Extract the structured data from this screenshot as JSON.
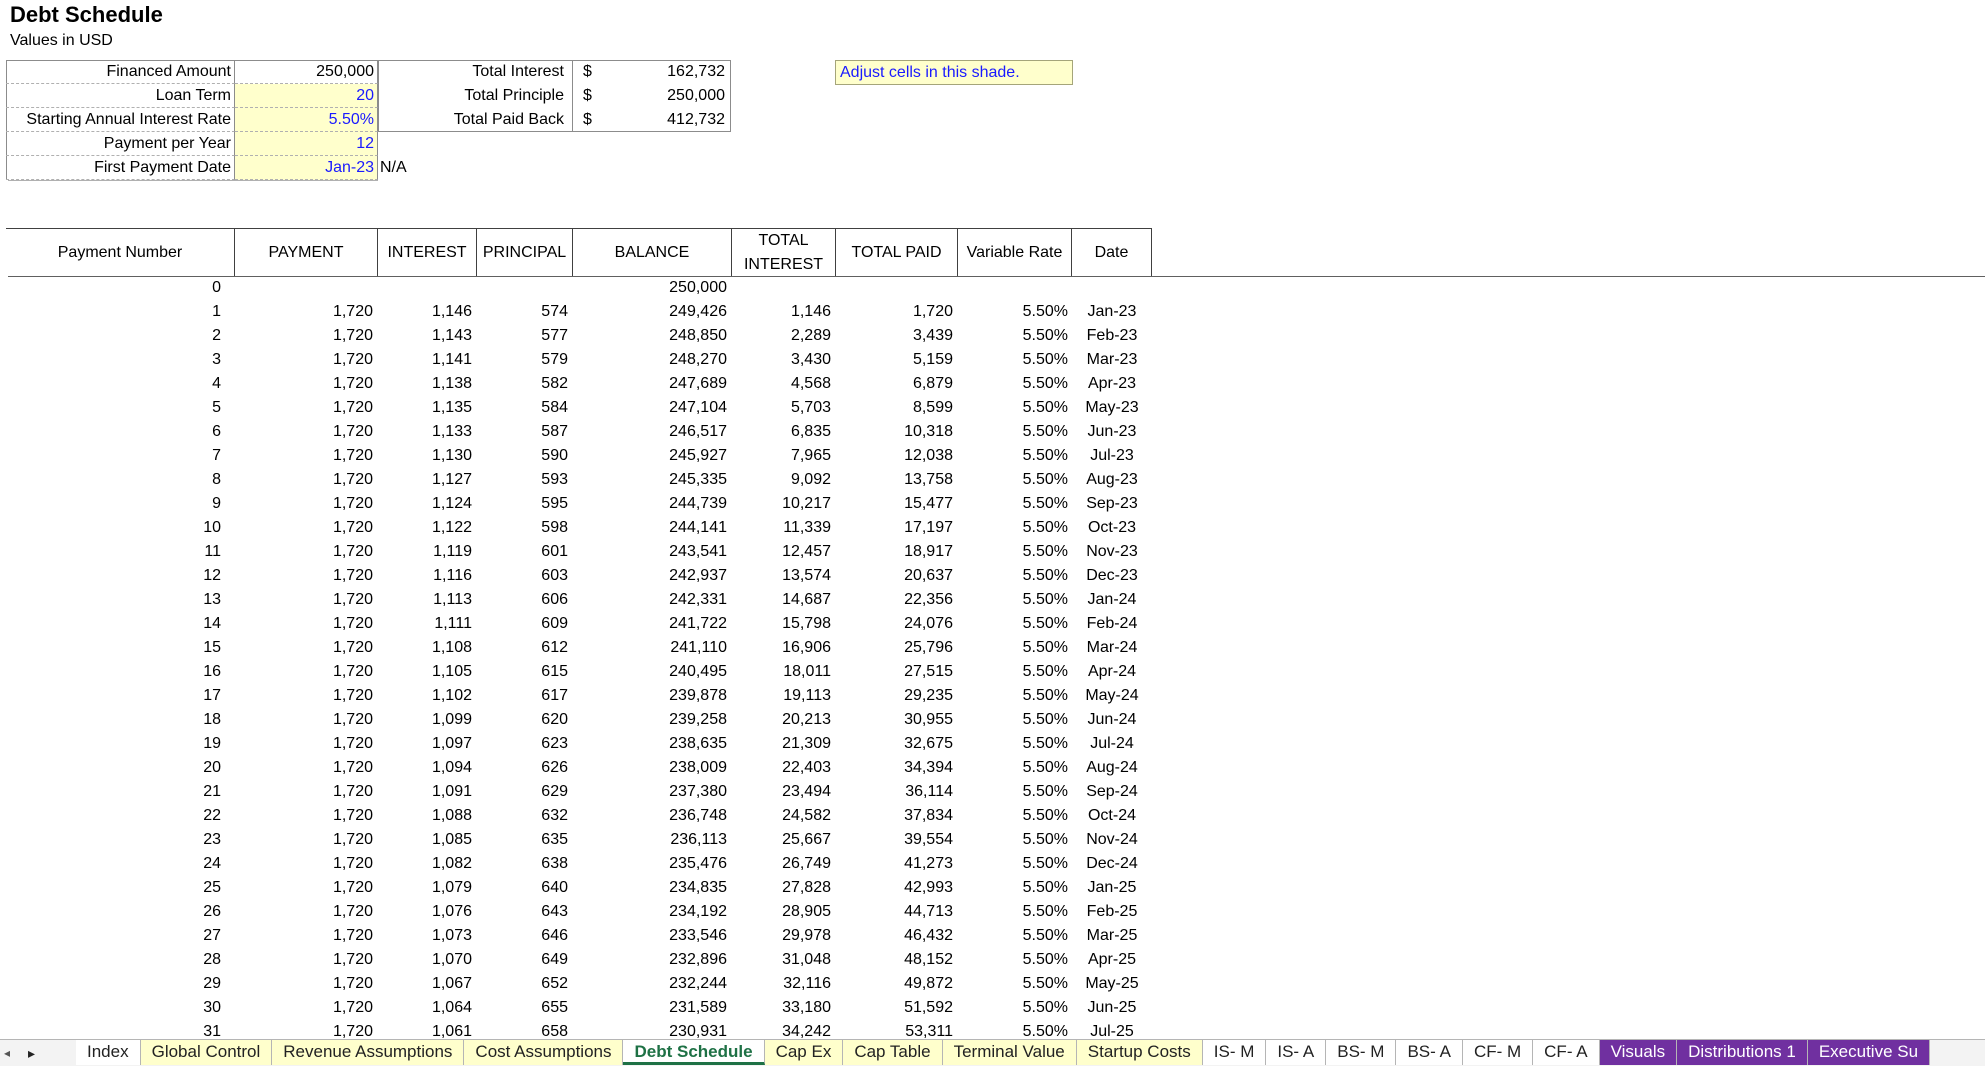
{
  "sheet": {
    "title": "Debt Schedule",
    "subtitle": "Values in USD"
  },
  "inputs": [
    {
      "label": "Financed Amount",
      "value": "250,000",
      "shaded": false
    },
    {
      "label": "Loan Term",
      "value": "20",
      "shaded": true
    },
    {
      "label": "Starting Annual Interest Rate",
      "value": "5.50%",
      "shaded": true
    },
    {
      "label": "Payment per Year",
      "value": "12",
      "shaded": true
    },
    {
      "label": "First Payment Date",
      "value": "Jan-23",
      "shaded": true
    }
  ],
  "na_text": "N/A",
  "totals": [
    {
      "label": "Total Interest",
      "currency": "$",
      "value": "162,732"
    },
    {
      "label": "Total Principle",
      "currency": "$",
      "value": "250,000"
    },
    {
      "label": "Total Paid Back",
      "currency": "$",
      "value": "412,732"
    }
  ],
  "note": "Adjust cells in this shade.",
  "columns": [
    "Payment Number",
    "PAYMENT",
    "INTEREST",
    "PRINCIPAL",
    "BALANCE",
    "TOTAL INTEREST",
    "TOTAL PAID",
    "Variable  Rate",
    "Date"
  ],
  "rows": [
    [
      "0",
      "",
      "",
      "",
      "250,000",
      "",
      "",
      "",
      ""
    ],
    [
      "1",
      "1,720",
      "1,146",
      "574",
      "249,426",
      "1,146",
      "1,720",
      "5.50%",
      "Jan-23"
    ],
    [
      "2",
      "1,720",
      "1,143",
      "577",
      "248,850",
      "2,289",
      "3,439",
      "5.50%",
      "Feb-23"
    ],
    [
      "3",
      "1,720",
      "1,141",
      "579",
      "248,270",
      "3,430",
      "5,159",
      "5.50%",
      "Mar-23"
    ],
    [
      "4",
      "1,720",
      "1,138",
      "582",
      "247,689",
      "4,568",
      "6,879",
      "5.50%",
      "Apr-23"
    ],
    [
      "5",
      "1,720",
      "1,135",
      "584",
      "247,104",
      "5,703",
      "8,599",
      "5.50%",
      "May-23"
    ],
    [
      "6",
      "1,720",
      "1,133",
      "587",
      "246,517",
      "6,835",
      "10,318",
      "5.50%",
      "Jun-23"
    ],
    [
      "7",
      "1,720",
      "1,130",
      "590",
      "245,927",
      "7,965",
      "12,038",
      "5.50%",
      "Jul-23"
    ],
    [
      "8",
      "1,720",
      "1,127",
      "593",
      "245,335",
      "9,092",
      "13,758",
      "5.50%",
      "Aug-23"
    ],
    [
      "9",
      "1,720",
      "1,124",
      "595",
      "244,739",
      "10,217",
      "15,477",
      "5.50%",
      "Sep-23"
    ],
    [
      "10",
      "1,720",
      "1,122",
      "598",
      "244,141",
      "11,339",
      "17,197",
      "5.50%",
      "Oct-23"
    ],
    [
      "11",
      "1,720",
      "1,119",
      "601",
      "243,541",
      "12,457",
      "18,917",
      "5.50%",
      "Nov-23"
    ],
    [
      "12",
      "1,720",
      "1,116",
      "603",
      "242,937",
      "13,574",
      "20,637",
      "5.50%",
      "Dec-23"
    ],
    [
      "13",
      "1,720",
      "1,113",
      "606",
      "242,331",
      "14,687",
      "22,356",
      "5.50%",
      "Jan-24"
    ],
    [
      "14",
      "1,720",
      "1,111",
      "609",
      "241,722",
      "15,798",
      "24,076",
      "5.50%",
      "Feb-24"
    ],
    [
      "15",
      "1,720",
      "1,108",
      "612",
      "241,110",
      "16,906",
      "25,796",
      "5.50%",
      "Mar-24"
    ],
    [
      "16",
      "1,720",
      "1,105",
      "615",
      "240,495",
      "18,011",
      "27,515",
      "5.50%",
      "Apr-24"
    ],
    [
      "17",
      "1,720",
      "1,102",
      "617",
      "239,878",
      "19,113",
      "29,235",
      "5.50%",
      "May-24"
    ],
    [
      "18",
      "1,720",
      "1,099",
      "620",
      "239,258",
      "20,213",
      "30,955",
      "5.50%",
      "Jun-24"
    ],
    [
      "19",
      "1,720",
      "1,097",
      "623",
      "238,635",
      "21,309",
      "32,675",
      "5.50%",
      "Jul-24"
    ],
    [
      "20",
      "1,720",
      "1,094",
      "626",
      "238,009",
      "22,403",
      "34,394",
      "5.50%",
      "Aug-24"
    ],
    [
      "21",
      "1,720",
      "1,091",
      "629",
      "237,380",
      "23,494",
      "36,114",
      "5.50%",
      "Sep-24"
    ],
    [
      "22",
      "1,720",
      "1,088",
      "632",
      "236,748",
      "24,582",
      "37,834",
      "5.50%",
      "Oct-24"
    ],
    [
      "23",
      "1,720",
      "1,085",
      "635",
      "236,113",
      "25,667",
      "39,554",
      "5.50%",
      "Nov-24"
    ],
    [
      "24",
      "1,720",
      "1,082",
      "638",
      "235,476",
      "26,749",
      "41,273",
      "5.50%",
      "Dec-24"
    ],
    [
      "25",
      "1,720",
      "1,079",
      "640",
      "234,835",
      "27,828",
      "42,993",
      "5.50%",
      "Jan-25"
    ],
    [
      "26",
      "1,720",
      "1,076",
      "643",
      "234,192",
      "28,905",
      "44,713",
      "5.50%",
      "Feb-25"
    ],
    [
      "27",
      "1,720",
      "1,073",
      "646",
      "233,546",
      "29,978",
      "46,432",
      "5.50%",
      "Mar-25"
    ],
    [
      "28",
      "1,720",
      "1,070",
      "649",
      "232,896",
      "31,048",
      "48,152",
      "5.50%",
      "Apr-25"
    ],
    [
      "29",
      "1,720",
      "1,067",
      "652",
      "232,244",
      "32,116",
      "49,872",
      "5.50%",
      "May-25"
    ],
    [
      "30",
      "1,720",
      "1,064",
      "655",
      "231,589",
      "33,180",
      "51,592",
      "5.50%",
      "Jun-25"
    ],
    [
      "31",
      "1,720",
      "1,061",
      "658",
      "230,931",
      "34,242",
      "53,311",
      "5.50%",
      "Jul-25"
    ]
  ],
  "tabs": [
    {
      "label": "Index",
      "style": "plain"
    },
    {
      "label": "Global Control",
      "style": "yellow"
    },
    {
      "label": "Revenue Assumptions",
      "style": "yellow"
    },
    {
      "label": "Cost Assumptions",
      "style": "yellow"
    },
    {
      "label": "Debt Schedule",
      "style": "active"
    },
    {
      "label": "Cap Ex",
      "style": "yellow"
    },
    {
      "label": "Cap Table",
      "style": "yellow"
    },
    {
      "label": "Terminal Value",
      "style": "yellow"
    },
    {
      "label": "Startup Costs",
      "style": "yellow"
    },
    {
      "label": "IS- M",
      "style": "plain"
    },
    {
      "label": "IS- A",
      "style": "plain"
    },
    {
      "label": "BS- M",
      "style": "plain"
    },
    {
      "label": "BS- A",
      "style": "plain"
    },
    {
      "label": "CF- M",
      "style": "plain"
    },
    {
      "label": "CF- A",
      "style": "plain"
    },
    {
      "label": "Visuals",
      "style": "purple"
    },
    {
      "label": "Distributions 1",
      "style": "purple"
    },
    {
      "label": "Executive Su",
      "style": "purple"
    }
  ],
  "colors": {
    "input_shade": "#ffffcc",
    "input_text": "#1a1aff",
    "active_tab": "#1e7145",
    "purple_tab": "#7030a0"
  }
}
